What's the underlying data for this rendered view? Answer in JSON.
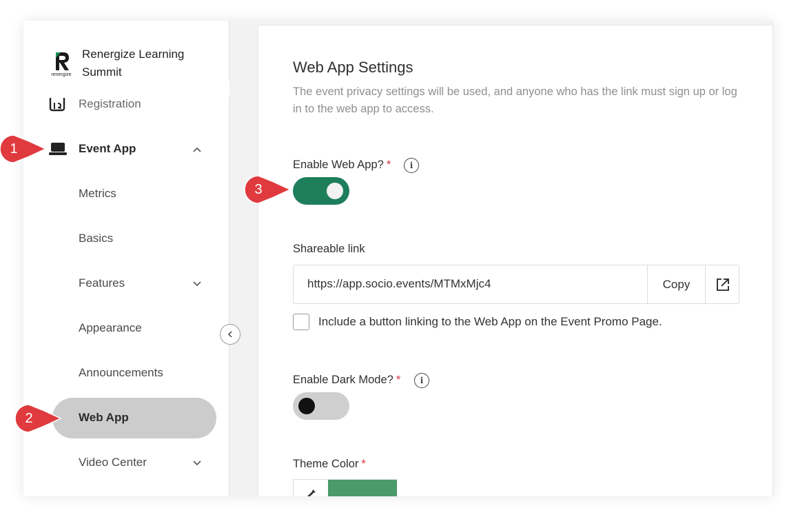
{
  "app": {
    "name": "Renergize Learning Summit",
    "logo_caption": "renergize"
  },
  "sidebar": {
    "items": [
      {
        "label": "Registration"
      },
      {
        "label": "Event App"
      },
      {
        "label": "Metrics"
      },
      {
        "label": "Basics"
      },
      {
        "label": "Features"
      },
      {
        "label": "Appearance"
      },
      {
        "label": "Announcements"
      },
      {
        "label": "Web App"
      },
      {
        "label": "Video Center"
      }
    ]
  },
  "content": {
    "title": "Web App Settings",
    "description": "The event privacy settings will be used, and anyone who has the link must sign up or log in to the web app to access.",
    "enable_web_app": {
      "label": "Enable Web App?",
      "required": "*",
      "info": "i",
      "enabled": true
    },
    "shareable_link": {
      "label": "Shareable link",
      "value": "https://app.socio.events/MTMxMjc4",
      "copy_label": "Copy"
    },
    "promo_checkbox": {
      "label": "Include a button linking to the Web App on the Event Promo Page.",
      "checked": false
    },
    "dark_mode": {
      "label": "Enable Dark Mode?",
      "required": "*",
      "info": "i",
      "enabled": false
    },
    "theme_color": {
      "label": "Theme Color",
      "required": "*",
      "value": "#4a9a6a"
    }
  },
  "annotations": [
    {
      "number": "1"
    },
    {
      "number": "2"
    },
    {
      "number": "3"
    }
  ],
  "colors": {
    "accent": "#1e7e5b",
    "callout": "#e03a3e",
    "active_pill": "#cccccc"
  }
}
